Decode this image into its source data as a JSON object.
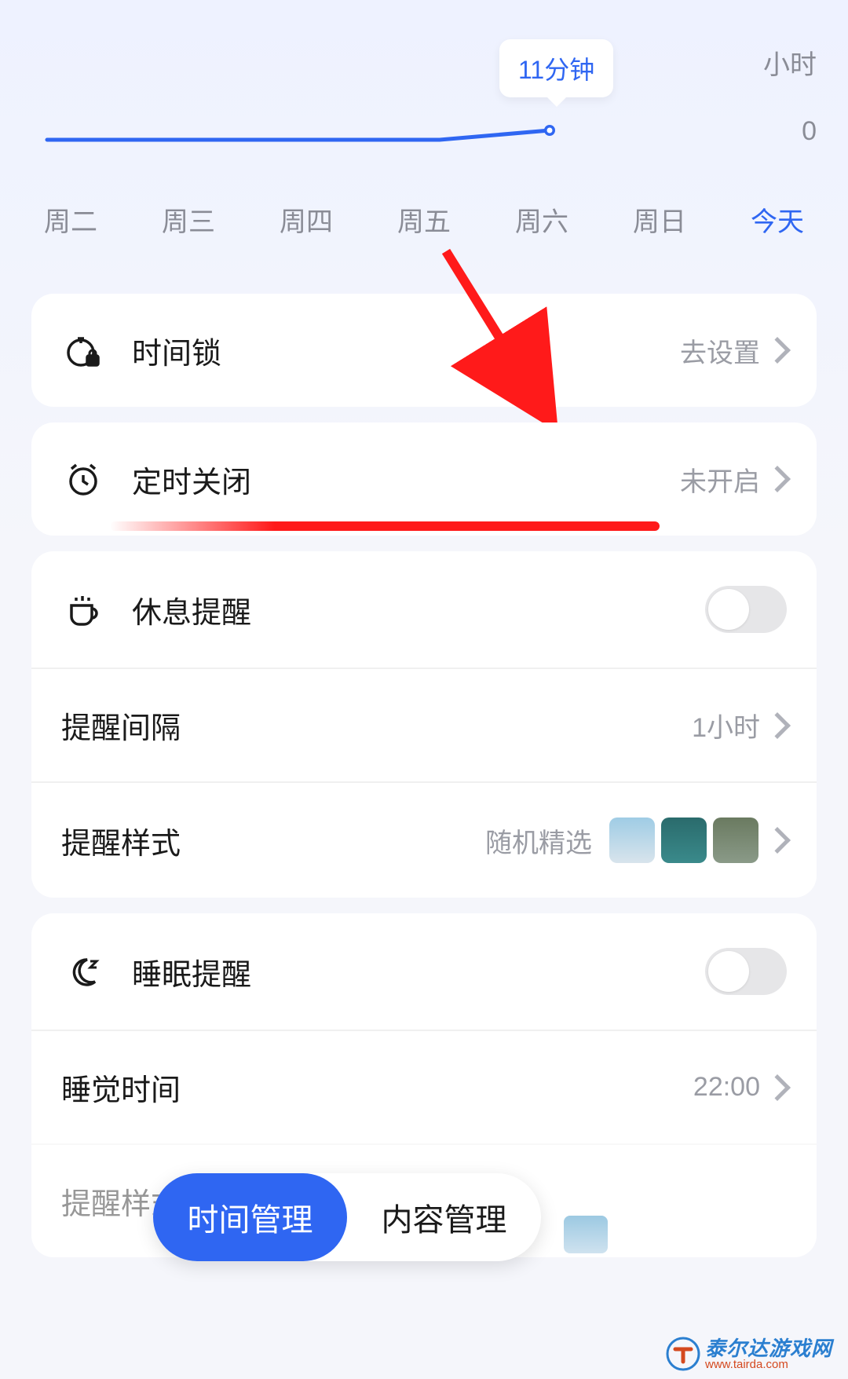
{
  "chart": {
    "tooltip": "11分钟",
    "hour_suffix": "小时",
    "zero": "0"
  },
  "days": [
    "周二",
    "周三",
    "周四",
    "周五",
    "周六",
    "周日",
    "今天"
  ],
  "days_active_index": 6,
  "cards": {
    "time_lock": {
      "label": "时间锁",
      "value": "去设置"
    },
    "timed_close": {
      "label": "定时关闭",
      "value": "未开启"
    },
    "rest_reminder": {
      "label": "休息提醒"
    },
    "remind_interval": {
      "label": "提醒间隔",
      "value": "1小时"
    },
    "remind_style": {
      "label": "提醒样式",
      "value": "随机精选"
    },
    "sleep_reminder": {
      "label": "睡眠提醒"
    },
    "sleep_time": {
      "label": "睡觉时间",
      "value": "22:00"
    },
    "cut_label": "提醒样式"
  },
  "bottom_tabs": {
    "time_mgmt": "时间管理",
    "content_mgmt": "内容管理"
  },
  "watermark": {
    "cn": "泰尔达游戏网",
    "url": "www.tairda.com"
  },
  "chart_data": {
    "type": "line",
    "categories": [
      "周二",
      "周三",
      "周四",
      "周五",
      "周六",
      "周日",
      "今天"
    ],
    "values": [
      0,
      0,
      0,
      0,
      0,
      0,
      11
    ],
    "unit": "分钟",
    "ylabel": "小时",
    "ylim_label": "0"
  }
}
